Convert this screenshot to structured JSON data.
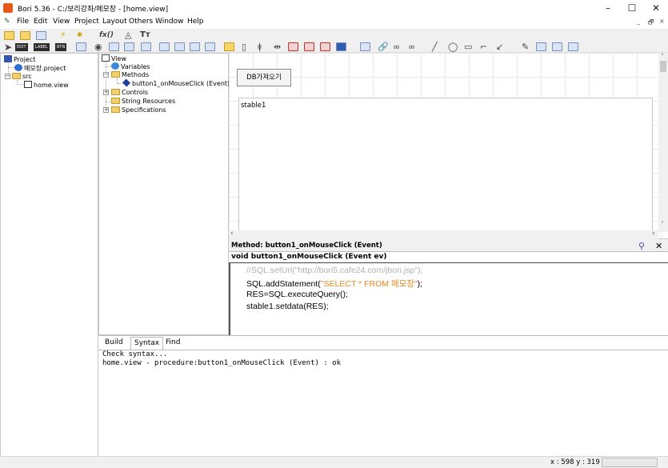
{
  "window": {
    "title": "Bori 5.36 - C:/보리강좌/메모장 - [home.view]",
    "minimize": "–",
    "maximize": "☐",
    "close": "✕"
  },
  "menu": {
    "items": [
      "File",
      "Edit",
      "View",
      "Project",
      "Layout",
      "Others",
      "Window",
      "Help"
    ],
    "mdi_buttons": [
      "_",
      "🗗",
      "×"
    ]
  },
  "toolbar": {
    "edit": "EDIT",
    "label": "LABEL",
    "btn": "BTN",
    "fx": "fx()",
    "tt": "Tт"
  },
  "project_tree": {
    "root": "Project",
    "project_file": "메모장.project",
    "src": "src",
    "view": "home.view"
  },
  "component_tree": {
    "view": "View",
    "variables": "Variables",
    "methods": "Methods",
    "method_item": "button1_onMouseClick (Event)",
    "controls": "Controls",
    "string_resources": "String Resources",
    "specifications": "Specifications"
  },
  "canvas": {
    "button_label": "DB가져오기",
    "table_label": "stable1"
  },
  "method_panel": {
    "header": "Method: button1_onMouseClick (Event)",
    "signature": "void button1_onMouseClick (Event ev)",
    "pin_icon": "⚲",
    "close": "✕"
  },
  "code": {
    "line1": "//SQL.setUrl(\"http://bori5.cafe24.com/jbori.jsp\");",
    "line2_a": "SQL.addStatement(",
    "line2_b": "\"SELECT * FROM 메모장\"",
    "line2_c": ");",
    "line3": "RES=SQL.executeQuery();",
    "line4": "stable1.setdata(RES);"
  },
  "bottom": {
    "tabs": [
      "Build",
      "Syntax",
      "Find"
    ],
    "active_tab": "Syntax",
    "output": [
      "Check syntax...",
      "home.view - procedure:button1_onMouseClick (Event) : ok"
    ]
  },
  "status": {
    "coords": "x : 598  y : 319"
  },
  "colors": {
    "comment": "#b0b0b0",
    "string": "#e8871e"
  }
}
